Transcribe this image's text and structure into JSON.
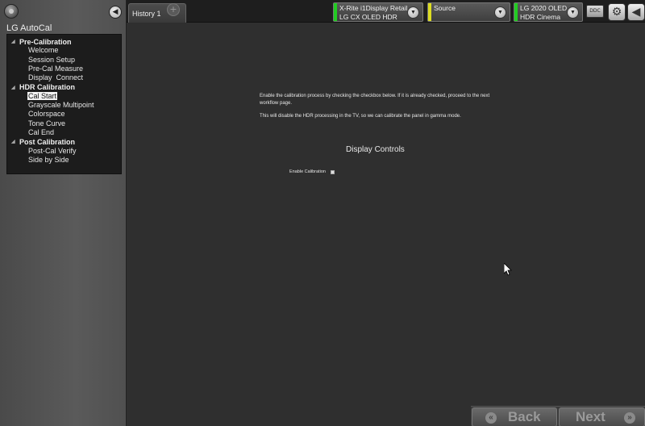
{
  "sidebar": {
    "app_title": "LG AutoCal",
    "groups": [
      {
        "label": "Pre-Calibration",
        "items": [
          "Welcome",
          "Session Setup",
          "Pre-Cal Measure",
          "Display  Connect"
        ]
      },
      {
        "label": "HDR Calibration",
        "items": [
          "Cal Start",
          "Grayscale Multipoint",
          "Colorspace",
          "Tone Curve",
          "Cal End"
        ]
      },
      {
        "label": "Post Calibration",
        "items": [
          "Post-Cal Verify",
          "Side by Side"
        ]
      }
    ],
    "selected_item": "Cal Start"
  },
  "topbar": {
    "tab_label": "History 1",
    "tab_add": "+",
    "meter": {
      "line1": "X-Rite i1Display Retail",
      "line2": "LG CX OLED HDR",
      "stripe_color": "#22cc22"
    },
    "source": {
      "line1": "Source",
      "line2": "",
      "stripe_color": "#dddd22"
    },
    "display": {
      "line1": "LG 2020 OLED",
      "line2": "HDR Cinema",
      "stripe_color": "#22cc22"
    },
    "ddc_label": "DDC"
  },
  "content": {
    "paragraph1": "Enable the calibration process by checking the checkbox below. If it is already checked, proceed to the next workflow page.",
    "paragraph2": "This will disable the HDR processing in the TV, so we can calibrate the panel in gamma mode.",
    "section_title": "Display Controls",
    "enable_label": "Enable Calibration",
    "enable_checked": false
  },
  "nav": {
    "back_label": "Back",
    "next_label": "Next"
  }
}
